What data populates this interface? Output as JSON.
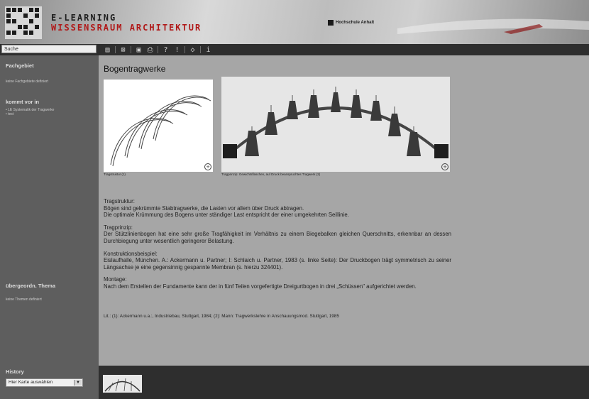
{
  "header": {
    "logo_line1": "E-LEARNING",
    "logo_line2": "WISSENSRAUM ARCHITEKTUR",
    "university": "Hochschule Anhalt"
  },
  "toolbar": {
    "search_value": "Suche",
    "icons": [
      "document-icon",
      "sitemap-icon",
      "print-preview-icon",
      "print-icon",
      "help-icon",
      "info-icon",
      "back-forward-icon",
      "info-i-icon"
    ]
  },
  "sidebar": {
    "fachgebiet_heading": "Fachgebiet",
    "fachgebiet_text": "keine Fachgebiete definiert",
    "kommt_vor_heading": "kommt vor in",
    "kommt_vor_items": [
      "• LE Systematik der Tragwerke",
      "• test"
    ],
    "thema_heading": "übergeordn. Thema",
    "thema_text": "keine Themen definiert",
    "history_heading": "History",
    "history_select": "Hier Karte auswählen"
  },
  "main": {
    "title": "Bogentragwerke",
    "caption_1": "Tragstruktur (1)",
    "caption_2": "Tragprinzip: Gewichtsflaschen, auf Druck beanspruchtes Tragwerk (2)",
    "paragraphs": [
      {
        "label": "Tragstruktur:",
        "text": "Bögen sind gekrümmte Stabtragwerke, die Lasten vor allem über Druck abtragen.\nDie optimale Krümmung des Bogens unter ständiger Last entspricht der einer umgekehrten Seillinie."
      },
      {
        "label": "Tragprinzip:",
        "text": "Der Stützlinienbogen hat eine sehr große Tragfähigkeit im Verhältnis zu einem Biegebalken gleichen Querschnitts, erkennbar an dessen Durchbiegung unter wesentlich geringerer Belastung."
      },
      {
        "label": "Konstruktionsbeispiel:",
        "text": "Eislaufhalle, München. A.: Ackermann u. Partner; I: Schlaich u. Partner, 1983 (s. linke Seite): Der Druckbogen trägt symmetrisch zu seiner Längsachse je eine gegensinnig gespannte Membran (s. hierzu 324401)."
      },
      {
        "label": "Montage:",
        "text": "Nach dem Erstellen der Fundamente kann der in fünf Teilen vorgefertigte Dreigurtbogen in drei „Schüssen\" aufgerichtet werden."
      }
    ],
    "literature": "Lit.: (1): Ackermann u.a.:, Industriebau, Stuttgart, 1984; (2): Mann: Tragwerkslehre in Anschauungsmod. Stuttgart, 1985"
  },
  "colors": {
    "header_red": "#b01818",
    "sidebar_bg": "#5e5e5e",
    "main_bg": "#a6a6a6",
    "bar_bg": "#2e2e2e"
  }
}
